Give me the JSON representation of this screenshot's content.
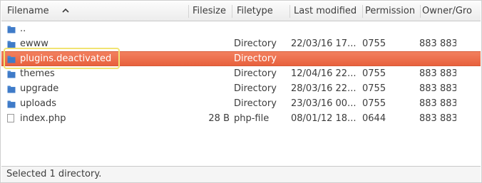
{
  "columns": {
    "filename": "Filename",
    "filesize": "Filesize",
    "filetype": "Filetype",
    "last_modified": "Last modified",
    "permission": "Permission",
    "owner_group": "Owner/Gro"
  },
  "sort": {
    "column": "filename",
    "direction": "ascending",
    "icon": "sort-up-icon"
  },
  "files": [
    {
      "name": "..",
      "size": "",
      "type": "",
      "modified": "",
      "permission": "",
      "owner": "",
      "icon": "folder-icon",
      "selected": false
    },
    {
      "name": "ewww",
      "size": "",
      "type": "Directory",
      "modified": "22/03/16 17...",
      "permission": "0755",
      "owner": "883 883",
      "icon": "folder-icon",
      "selected": false
    },
    {
      "name": "plugins.deactivated",
      "size": "",
      "type": "Directory",
      "modified": "",
      "permission": "",
      "owner": "",
      "icon": "folder-icon",
      "selected": true
    },
    {
      "name": "themes",
      "size": "",
      "type": "Directory",
      "modified": "12/04/16 22...",
      "permission": "0755",
      "owner": "883 883",
      "icon": "folder-icon",
      "selected": false
    },
    {
      "name": "upgrade",
      "size": "",
      "type": "Directory",
      "modified": "28/03/16 22...",
      "permission": "0755",
      "owner": "883 883",
      "icon": "folder-icon",
      "selected": false
    },
    {
      "name": "uploads",
      "size": "",
      "type": "Directory",
      "modified": "23/03/16 00...",
      "permission": "0755",
      "owner": "883 883",
      "icon": "folder-icon",
      "selected": false
    },
    {
      "name": "index.php",
      "size": "28 B",
      "type": "php-file",
      "modified": "08/01/12 18...",
      "permission": "0644",
      "owner": "883 883",
      "icon": "file-icon",
      "selected": false
    }
  ],
  "status": {
    "text": "Selected 1 directory."
  },
  "colors": {
    "selection": "#e8673f",
    "highlight_outline": "#f1e473",
    "folder": "#4a86cf"
  }
}
